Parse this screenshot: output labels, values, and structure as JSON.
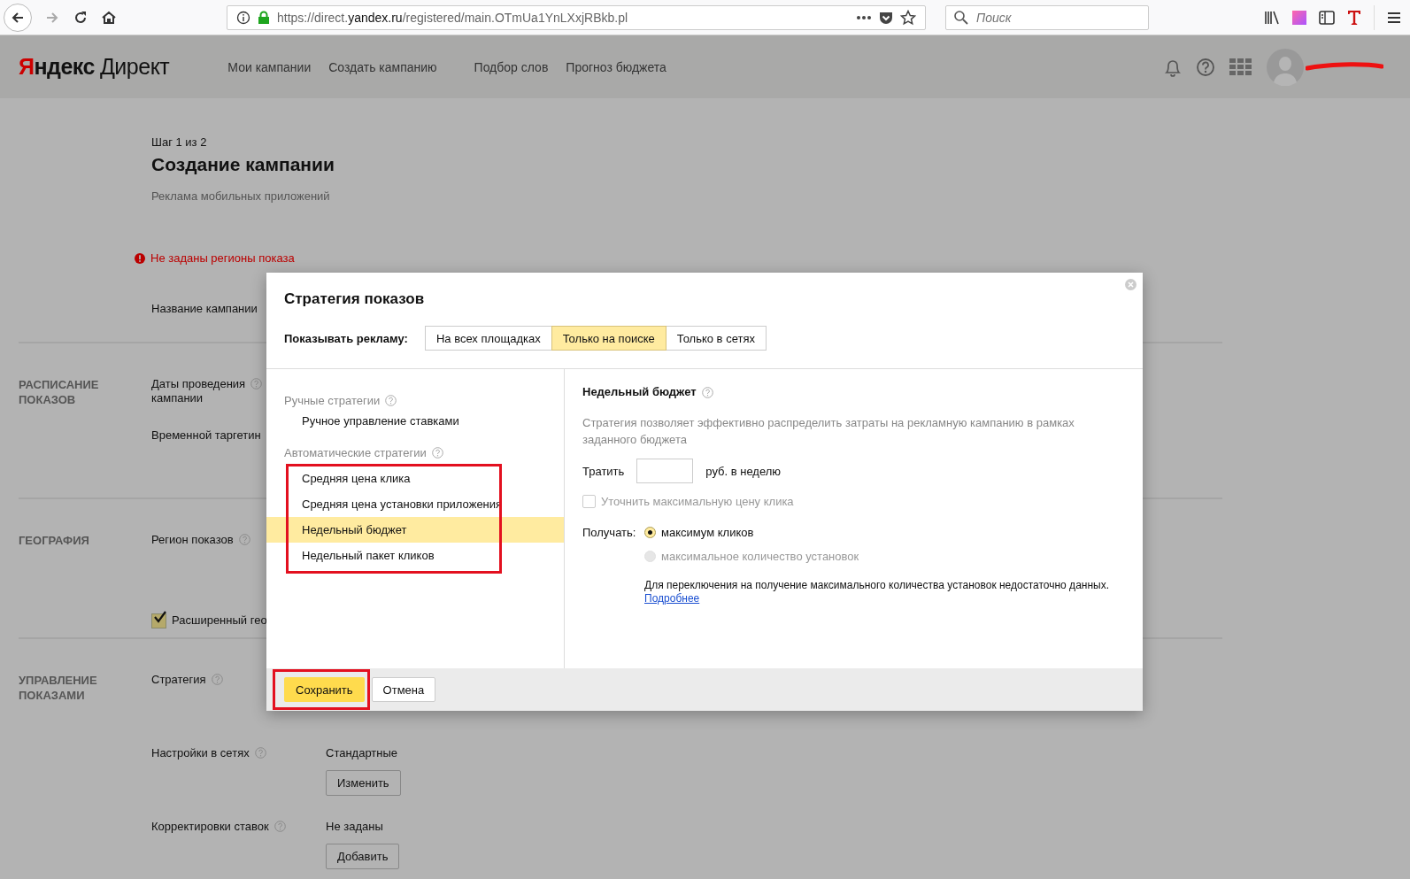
{
  "browser": {
    "url_prefix": "https://direct.",
    "url_domain": "yandex.ru",
    "url_path": "/registered/main.OTmUa1YnLXxjRBkb.pl",
    "search_placeholder": "Поиск"
  },
  "header": {
    "logo_first": "Я",
    "logo_rest": "ндекс",
    "logo_product": "Директ",
    "nav": [
      "Мои кампании",
      "Создать кампанию",
      "Подбор слов",
      "Прогноз бюджета"
    ]
  },
  "page": {
    "step": "Шаг 1 из 2",
    "title": "Создание кампании",
    "subtitle": "Реклама мобильных приложений",
    "error": "Не заданы регионы показа",
    "campaign_name_label": "Название кампании"
  },
  "sections": [
    {
      "heading": "РАСПИСАНИЕ ПОКАЗОВ",
      "fields": [
        {
          "kind": "label",
          "label": "Даты проведения\nкампании",
          "help": true
        },
        {
          "kind": "label",
          "label": "Временной таргетин",
          "help": false
        }
      ]
    },
    {
      "heading": "ГЕОГРАФИЯ",
      "fields": [
        {
          "kind": "label",
          "label": "Регион показов",
          "help": true
        },
        {
          "kind": "checkbox",
          "label": "Расширенный гео",
          "checked": true
        }
      ]
    },
    {
      "heading": "УПРАВЛЕНИЕ ПОКАЗАМИ",
      "fields": [
        {
          "kind": "label",
          "label": "Стратегия",
          "help": true
        },
        {
          "kind": "label",
          "label": "Настройки в сетях",
          "help": true,
          "value": "Стандартные",
          "button": "Изменить"
        },
        {
          "kind": "label",
          "label": "Корректировки ставок",
          "help": true,
          "value": "Не заданы",
          "button": "Добавить"
        }
      ]
    }
  ],
  "modal": {
    "title": "Стратегия показов",
    "show_label": "Показывать рекламу:",
    "tabs": [
      {
        "label": "На всех площадках",
        "selected": false
      },
      {
        "label": "Только на поиске",
        "selected": true
      },
      {
        "label": "Только в сетях",
        "selected": false
      }
    ],
    "manual_heading": "Ручные стратегии",
    "manual_items": [
      {
        "label": "Ручное управление ставками",
        "selected": false
      }
    ],
    "auto_heading": "Автоматические стратегии",
    "auto_items": [
      {
        "label": "Средняя цена клика",
        "selected": false
      },
      {
        "label": "Средняя цена установки приложения",
        "selected": false
      },
      {
        "label": "Недельный бюджет",
        "selected": true
      },
      {
        "label": "Недельный пакет кликов",
        "selected": false
      }
    ],
    "detail_heading": "Недельный бюджет",
    "description": "Стратегия позволяет эффективно распределить затраты на рекламную кампанию в рамках заданного бюджета",
    "spend_label": "Тратить",
    "spend_suffix": "руб. в неделю",
    "refine": {
      "label": "Уточнить максимальную цену клика",
      "checked": false,
      "disabled": true
    },
    "receive_label": "Получать:",
    "radios": [
      {
        "label": "максимум кликов",
        "selected": true,
        "disabled": false
      },
      {
        "label": "максимальное количество установок",
        "selected": false,
        "disabled": true
      }
    ],
    "note": "Для переключения на получение максимального количества установок недостаточно данных.",
    "link": "Подробнее",
    "save": "Сохранить",
    "cancel": "Отмена"
  }
}
